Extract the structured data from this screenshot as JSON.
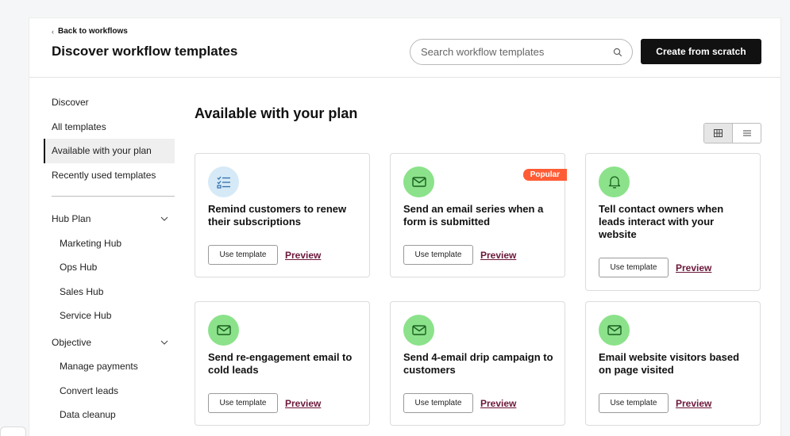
{
  "header": {
    "back_label": "Back to workflows",
    "title": "Discover workflow templates",
    "search_placeholder": "Search workflow templates",
    "create_label": "Create from scratch"
  },
  "sidebar": {
    "items": [
      {
        "label": "Discover"
      },
      {
        "label": "All templates"
      },
      {
        "label": "Available with your plan",
        "active": true
      },
      {
        "label": "Recently used templates"
      }
    ],
    "groups": [
      {
        "label": "Hub Plan",
        "children": [
          "Marketing Hub",
          "Ops Hub",
          "Sales Hub",
          "Service Hub"
        ]
      },
      {
        "label": "Objective",
        "children": [
          "Manage payments",
          "Convert leads",
          "Data cleanup"
        ]
      }
    ]
  },
  "main": {
    "section_title": "Available with your plan",
    "view_toggle": {
      "selected": "grid"
    },
    "cards": [
      {
        "title": "Remind customers to renew their subscriptions",
        "icon": "checklist-icon",
        "icon_bg": "#d6e9f7",
        "icon_color": "#2f6fa8",
        "use_label": "Use template",
        "preview_label": "Preview"
      },
      {
        "title": "Send an email series when a form is submitted",
        "icon": "email-icon",
        "icon_bg": "#8be28a",
        "icon_color": "#1b5e20",
        "use_label": "Use template",
        "preview_label": "Preview",
        "badge": "Popular"
      },
      {
        "title": "Tell contact owners when leads interact with your website",
        "icon": "bell-icon",
        "icon_bg": "#8be28a",
        "icon_color": "#1b5e20",
        "use_label": "Use template",
        "preview_label": "Preview"
      },
      {
        "title": "Send re-engagement email to cold leads",
        "icon": "email-icon",
        "icon_bg": "#8be28a",
        "icon_color": "#1b5e20",
        "use_label": "Use template",
        "preview_label": "Preview"
      },
      {
        "title": "Send 4-email drip campaign to customers",
        "icon": "email-icon",
        "icon_bg": "#8be28a",
        "icon_color": "#1b5e20",
        "use_label": "Use template",
        "preview_label": "Preview"
      },
      {
        "title": "Email website visitors based on page visited",
        "icon": "email-icon",
        "icon_bg": "#8be28a",
        "icon_color": "#1b5e20",
        "use_label": "Use template",
        "preview_label": "Preview"
      }
    ]
  },
  "colors": {
    "accent_dark": "#111111",
    "preview_link": "#6b1739",
    "popular_badge": "#ff5c35"
  }
}
